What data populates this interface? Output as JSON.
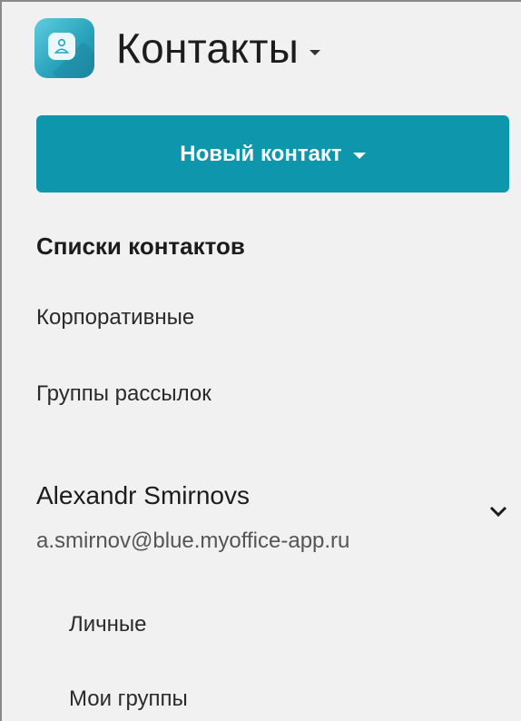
{
  "header": {
    "app_title": "Контакты",
    "icon": "contacts-app-icon"
  },
  "actions": {
    "new_contact_label": "Новый контакт"
  },
  "sidebar": {
    "section_title": "Списки контактов",
    "items": [
      {
        "label": "Корпоративные"
      },
      {
        "label": "Группы рассылок"
      }
    ]
  },
  "account": {
    "name": "Alexandr Smirnovs",
    "email": "a.smirnov@blue.myoffice-app.ru",
    "expanded": true,
    "items": [
      {
        "label": "Личные"
      },
      {
        "label": "Мои группы"
      }
    ]
  },
  "colors": {
    "accent": "#0e96ad",
    "background": "#f1f1f1"
  }
}
